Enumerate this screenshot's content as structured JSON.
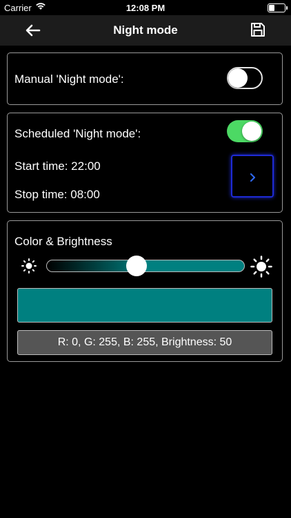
{
  "status_bar": {
    "carrier": "Carrier",
    "time": "12:08 PM"
  },
  "nav": {
    "title": "Night mode",
    "back_icon": "arrow-left-icon",
    "save_icon": "floppy-disk-icon"
  },
  "manual": {
    "label": "Manual 'Night mode':",
    "enabled": false
  },
  "scheduled": {
    "label": "Scheduled 'Night mode':",
    "enabled": true,
    "start_time": "Start time: 22:00",
    "stop_time": "Stop time: 08:00",
    "toggle_color": "#4cd964",
    "button_border_color": "#1e2bd6"
  },
  "color_brightness": {
    "label": "Color & Brightness",
    "brightness": 50,
    "swatch_color": "#008080",
    "readout": "R: 0, G: 255, B: 255, Brightness: 50"
  }
}
